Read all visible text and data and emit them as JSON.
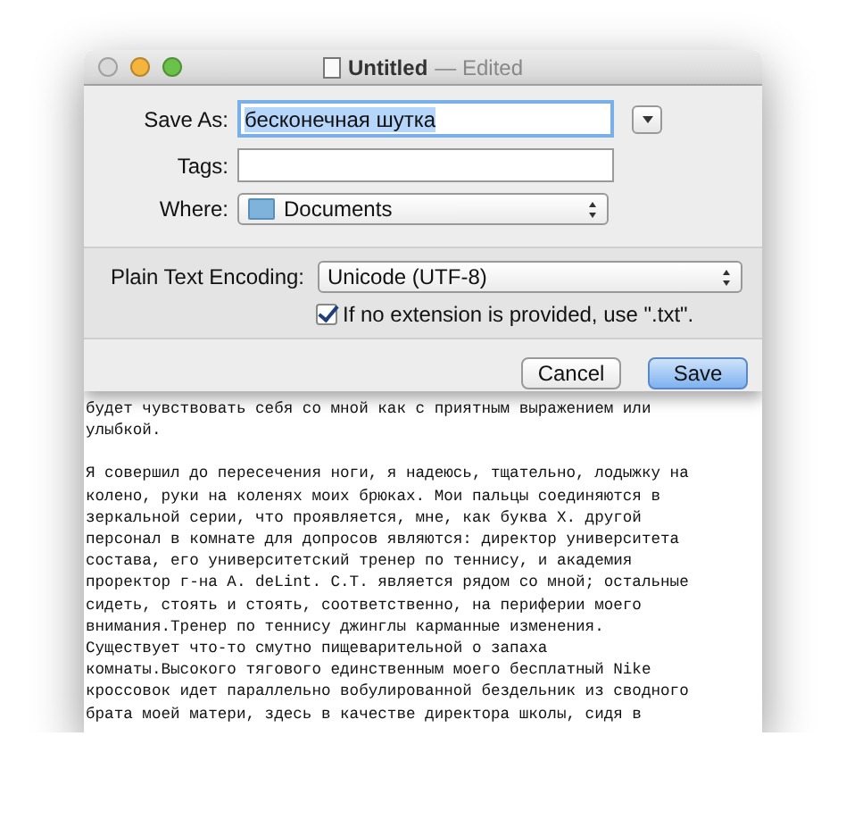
{
  "window": {
    "title": "Untitled",
    "subtitle": "— Edited"
  },
  "save_sheet": {
    "save_as": {
      "label": "Save As:",
      "value": "бесконечная шутка",
      "selected": true
    },
    "tags": {
      "label": "Tags:"
    },
    "where": {
      "label": "Where:",
      "value": "Documents"
    },
    "encoding": {
      "label": "Plain Text Encoding:",
      "value": "Unicode (UTF-8)"
    },
    "extension_option": {
      "label": "If no extension is provided, use \".txt\".",
      "checked": true
    },
    "buttons": [
      {
        "label": "Cancel",
        "kind": "normal"
      },
      {
        "label": "Save",
        "kind": "default"
      }
    ]
  },
  "document": {
    "paragraphs": [
      "будет чувствовать себя со мной как с приятным выражением или\nулыбкой.",
      "Я совершил до пересечения ноги, я надеюсь, тщательно, лодыжку на\nколено, руки на коленях моих брюках. Мои пальцы соединяются в\nзеркальной серии, что проявляется, мне, как буква X. другой\nперсонал в комнате для допросов являются: директор университета\nсостава, его университетский тренер по теннису, и академия\nпроректор г-на A. deLint. C.T. является рядом со мной; остальные\nсидеть, стоять и стоять, соответственно, на периферии моего\nвнимания.Тренер по теннису джинглы карманные изменения.\nСуществует что-то смутно пищеварительной о запаха\nкомнаты.Высокого тягового единственным моего бесплатный Nike\nкроссовок идет параллельно вобулированной бездельник из сводного\nбрата моей матери, здесь в качестве директора школы, сидя в"
    ]
  }
}
